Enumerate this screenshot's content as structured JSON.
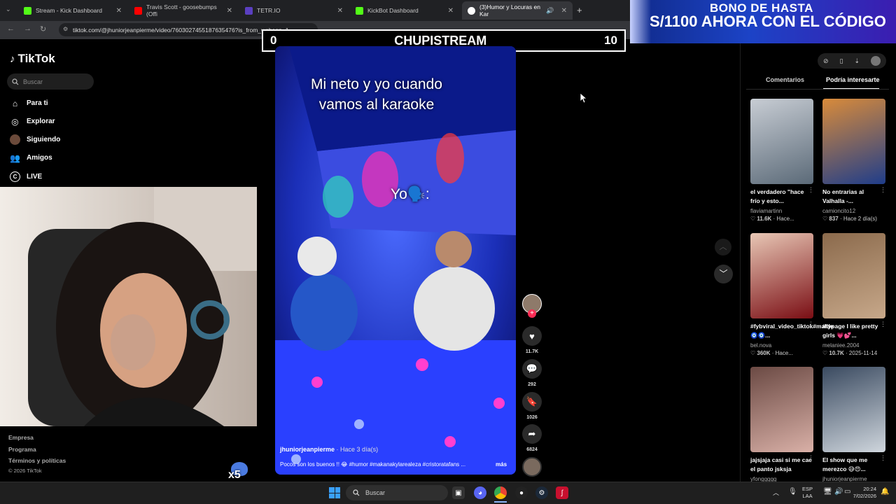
{
  "browser": {
    "tabs": [
      {
        "title": "Stream - Kick Dashboard",
        "color": "#53fc18"
      },
      {
        "title": "Travis Scott - goosebumps (Offi",
        "color": "#ff0000"
      },
      {
        "title": "TETR.IO",
        "color": "#5a3fc0"
      },
      {
        "title": "KickBot Dashboard",
        "color": "#53fc18"
      },
      {
        "title": "(3)Humor y Locuras en Kar",
        "color": "#ffffff"
      }
    ],
    "url": "tiktok.com/@jhuniorjeanpierme/video/7603027455187635476?is_from_webapp=1"
  },
  "ad": {
    "line1": "BONO DE HASTA",
    "line2": "S/1100 AHORA CON EL CÓDIGO"
  },
  "scoreboard": {
    "left": "0",
    "title": "CHUPISTREAM",
    "right": "10"
  },
  "tiktok": {
    "logo": "TikTok",
    "search_placeholder": "Buscar",
    "nav": [
      "Para ti",
      "Explorar",
      "Siguiendo",
      "Amigos",
      "LIVE"
    ],
    "footer": [
      "Empresa",
      "Programa",
      "Términos y políticas",
      "© 2026 TikTok"
    ]
  },
  "video": {
    "caption_top": "Mi neto y yo cuando\nvamos al karaoke",
    "caption_mid": "Yo🗣️:",
    "author": "jhuniorjeanpierme",
    "age": "· Hace 3 día(s)",
    "description": "Pocos son los buenos !! 😂 #humor #makanakylarealeza #cristoratafans ...",
    "more": "más",
    "likes": "11.7K",
    "comments": "292",
    "saves": "1026",
    "shares": "6824"
  },
  "right_panel": {
    "tabs": [
      "Comentarios",
      "Podría interesarte"
    ],
    "items": [
      {
        "title": "el verdadero \"hace frío y esto...",
        "author": "flaviamartinn",
        "likes": "11.6K",
        "when": "Hace...",
        "c1": "#5b6a78",
        "c2": "#c8cdd4"
      },
      {
        "title": "No entrarias al Valhalla -...",
        "author": "camioncito12",
        "likes": "837",
        "when": "Hace 2 día(s)",
        "c1": "#1f3d8a",
        "c2": "#d98b3a"
      },
      {
        "title": "#fybviral_video_tiktok#malde🧿🧿...",
        "author": "bel.nova",
        "likes": "360K",
        "when": "Hace...",
        "c1": "#7a0e14",
        "c2": "#e8c7b5"
      },
      {
        "title": "#fypage I like pretty girls 💗💕...",
        "author": "melaniee.2004",
        "likes": "10.7K",
        "when": "2025-11-14",
        "c1": "#c7a88a",
        "c2": "#8b6a4c"
      },
      {
        "title": "jajsjaja casi si me cae el panto jsksja",
        "author": "yfonggggg",
        "likes": "",
        "when": "",
        "c1": "#d9b0a7",
        "c2": "#6b4a44"
      },
      {
        "title": "El show que me merezco 😅😍...",
        "author": "jhuniorjeanpierme",
        "likes": "",
        "when": "",
        "c1": "#cfd6dd",
        "c2": "#3a4a60"
      }
    ]
  },
  "overlay": {
    "multiplier": "x5"
  },
  "taskbar": {
    "search_placeholder": "Buscar",
    "lang": "ESP",
    "lang2": "LAA",
    "time": "20:24",
    "date": "7/02/2026"
  }
}
